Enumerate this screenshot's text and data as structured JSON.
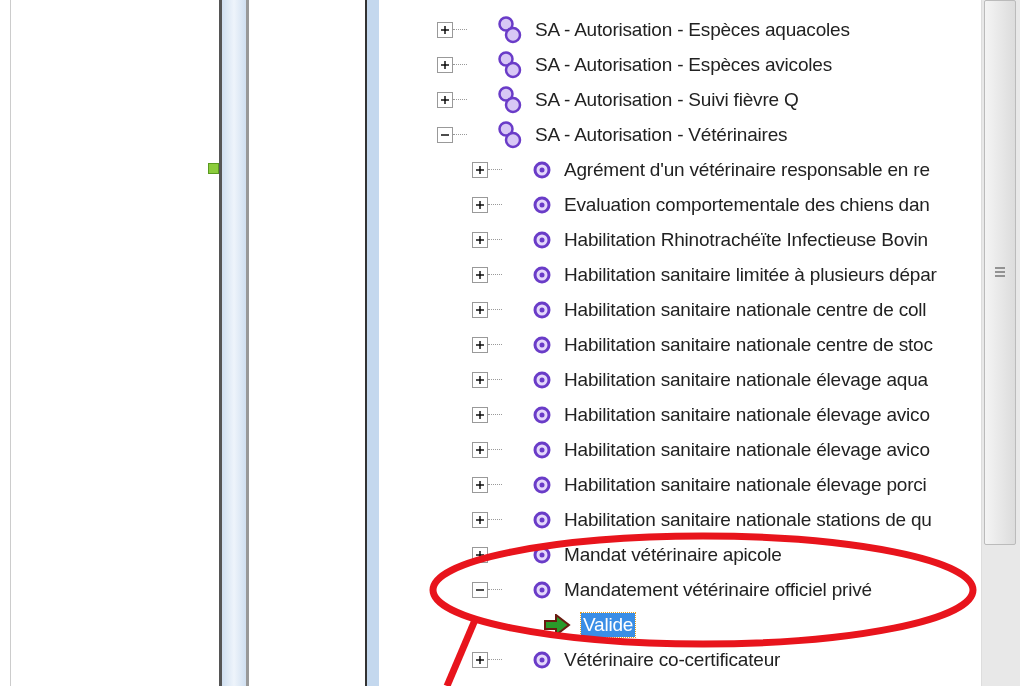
{
  "tree": [
    {
      "label": "SA - Autorisation - Espèces aquacoles",
      "kind": "group",
      "expanded": false,
      "selected": false
    },
    {
      "label": "SA - Autorisation - Espèces avicoles",
      "kind": "group",
      "expanded": false,
      "selected": false
    },
    {
      "label": "SA - Autorisation - Suivi fièvre Q",
      "kind": "group",
      "expanded": false,
      "selected": false
    },
    {
      "label": "SA - Autorisation - Vétérinaires",
      "kind": "group",
      "expanded": true,
      "selected": false,
      "children": [
        {
          "label": "Agrément d'un vétérinaire responsable en re",
          "kind": "item",
          "expanded": false,
          "selected": false
        },
        {
          "label": "Evaluation comportementale des chiens dan",
          "kind": "item",
          "expanded": false,
          "selected": false
        },
        {
          "label": "Habilitation Rhinotrachéïte Infectieuse Bovin",
          "kind": "item",
          "expanded": false,
          "selected": false
        },
        {
          "label": "Habilitation sanitaire limitée à plusieurs dépar",
          "kind": "item",
          "expanded": false,
          "selected": false
        },
        {
          "label": "Habilitation sanitaire nationale centre de coll",
          "kind": "item",
          "expanded": false,
          "selected": false
        },
        {
          "label": "Habilitation sanitaire nationale centre de stoc",
          "kind": "item",
          "expanded": false,
          "selected": false
        },
        {
          "label": "Habilitation sanitaire nationale élevage aqua",
          "kind": "item",
          "expanded": false,
          "selected": false
        },
        {
          "label": "Habilitation sanitaire nationale élevage avico",
          "kind": "item",
          "expanded": false,
          "selected": false
        },
        {
          "label": "Habilitation sanitaire nationale élevage avico",
          "kind": "item",
          "expanded": false,
          "selected": false
        },
        {
          "label": "Habilitation sanitaire nationale élevage porci",
          "kind": "item",
          "expanded": false,
          "selected": false
        },
        {
          "label": "Habilitation sanitaire nationale stations de qu",
          "kind": "item",
          "expanded": false,
          "selected": false
        },
        {
          "label": "Mandat vétérinaire apicole",
          "kind": "item",
          "expanded": false,
          "selected": false
        },
        {
          "label": "Mandatement vétérinaire officiel privé",
          "kind": "item",
          "expanded": true,
          "selected": false,
          "children": [
            {
              "label": "Valide",
              "kind": "status",
              "selected": true
            }
          ]
        },
        {
          "label": "Vétérinaire co-certificateur",
          "kind": "item",
          "expanded": false,
          "selected": false
        }
      ]
    }
  ]
}
